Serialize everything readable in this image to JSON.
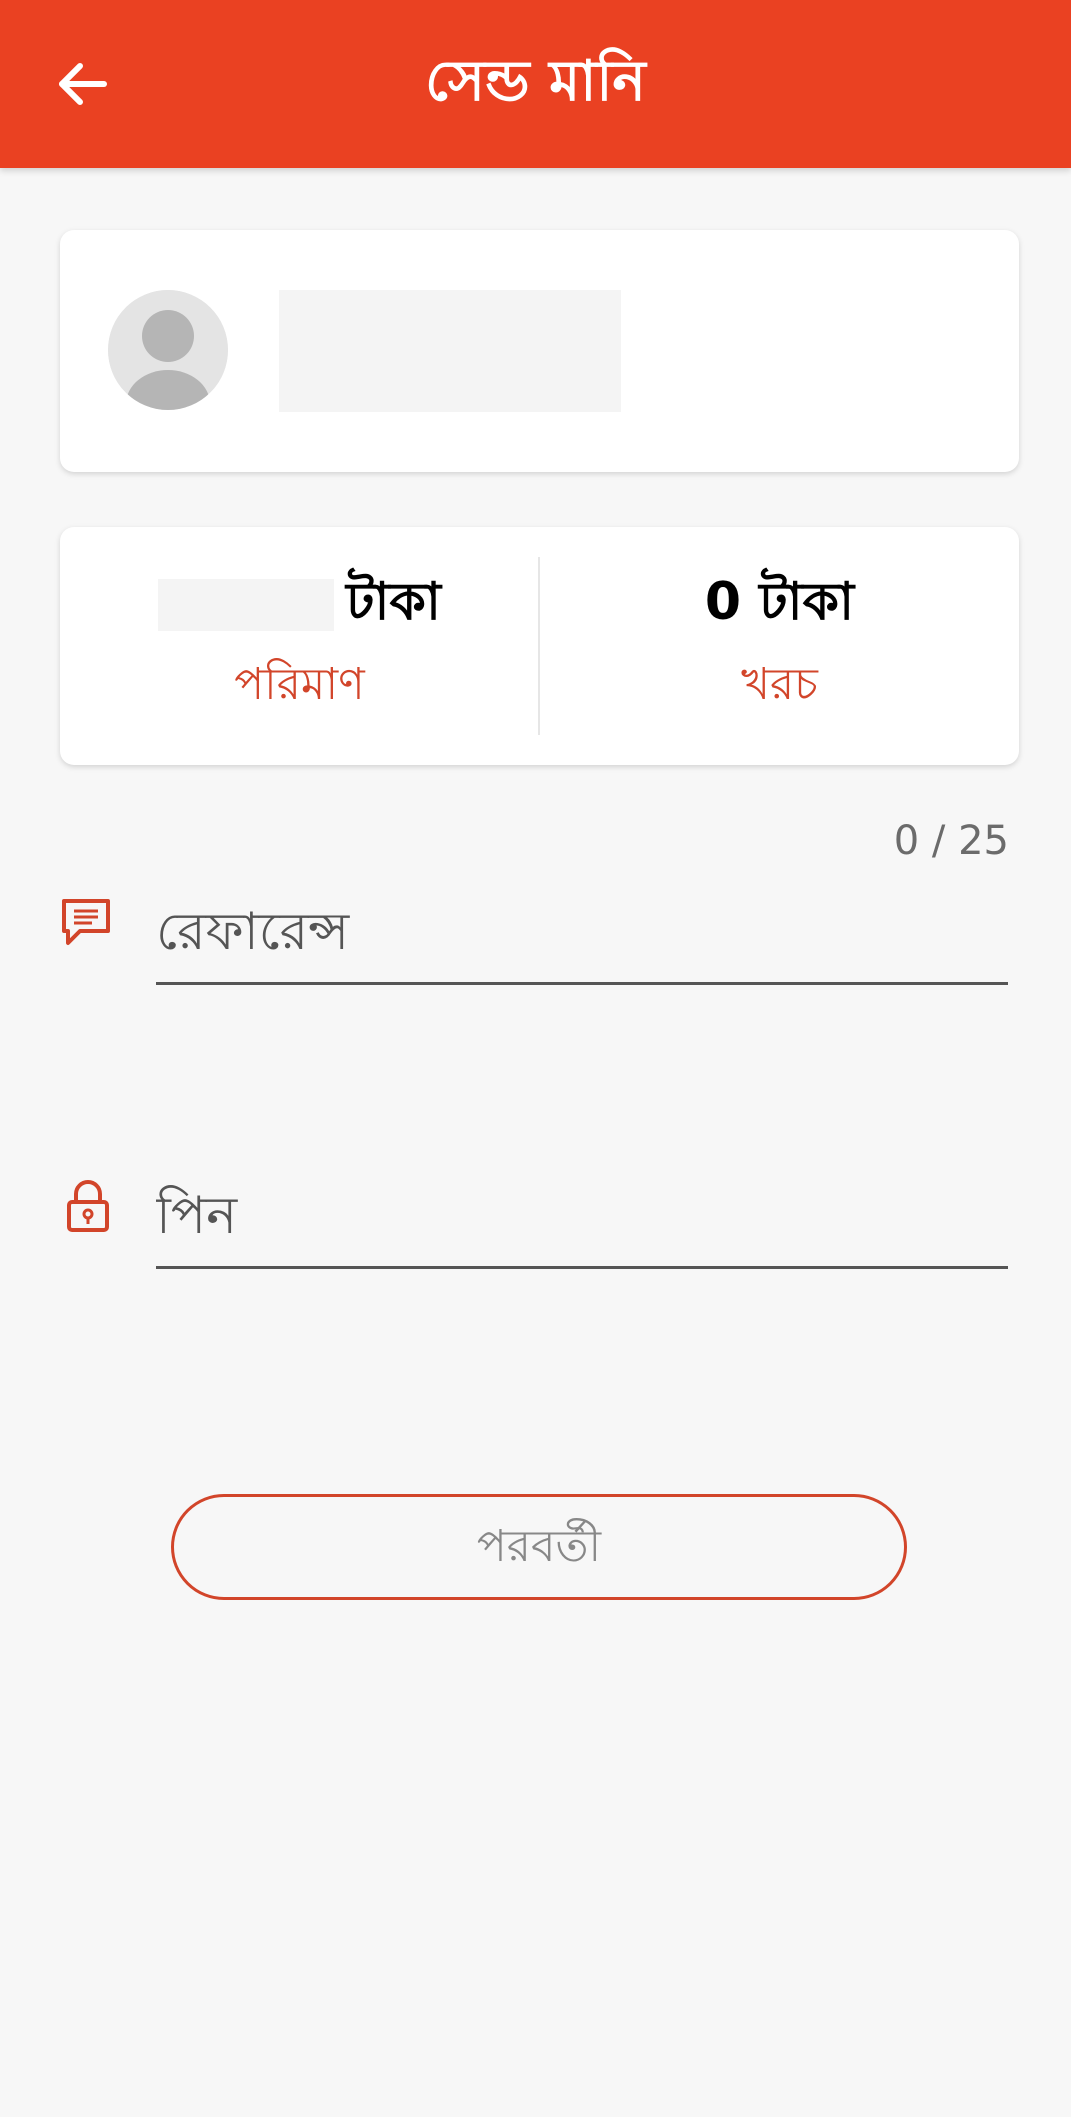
{
  "header": {
    "title": "সেন্ড মানি",
    "back_icon": "arrow-left-icon"
  },
  "recipient": {
    "avatar_icon": "person-avatar-icon",
    "name": ""
  },
  "amount": {
    "amount_value": "",
    "amount_unit": "টাকা",
    "amount_label": "পরিমাণ",
    "charge_value": "0 টাকা",
    "charge_label": "খরচ"
  },
  "reference": {
    "icon": "message-icon",
    "placeholder": "রেফারেন্স",
    "counter": "0 / 25"
  },
  "pin": {
    "icon": "lock-icon",
    "placeholder": "পিন"
  },
  "actions": {
    "next_label": "পরবর্তী"
  },
  "colors": {
    "brand": "#ea4122",
    "accent": "#d2452a",
    "background": "#f7f7f7"
  }
}
